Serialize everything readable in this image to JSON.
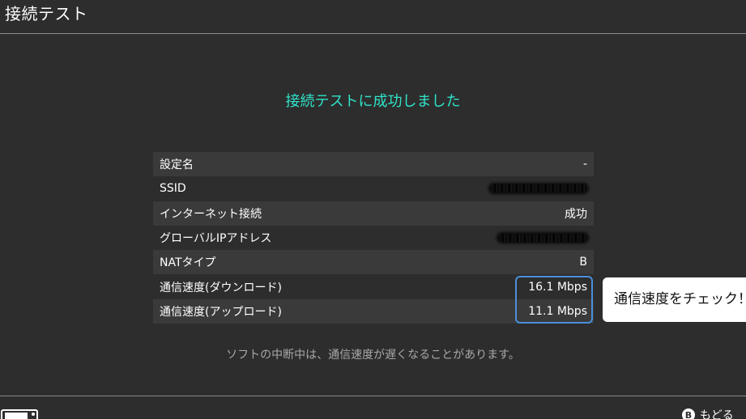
{
  "header": {
    "title": "接続テスト"
  },
  "result": {
    "title": "接続テストに成功しました"
  },
  "rows": [
    {
      "label": "設定名",
      "value": "-"
    },
    {
      "label": "SSID",
      "value": ""
    },
    {
      "label": "インターネット接続",
      "value": "成功"
    },
    {
      "label": "グローバルIPアドレス",
      "value": ""
    },
    {
      "label": "NATタイプ",
      "value": "B"
    },
    {
      "label": "通信速度(ダウンロード)",
      "value": "16.1 Mbps"
    },
    {
      "label": "通信速度(アップロード)",
      "value": "11.1 Mbps"
    }
  ],
  "callout": {
    "text": "通信速度をチェック！"
  },
  "note": "ソフトの中断中は、通信速度が遅くなることがあります。",
  "footer": {
    "back_icon": "B",
    "back_label": "もどる"
  },
  "colors": {
    "background": "#2d2d2d",
    "accent": "#2fe3c9",
    "highlight_border": "#4a8fd9",
    "row_shade": "#3a3a3a"
  }
}
